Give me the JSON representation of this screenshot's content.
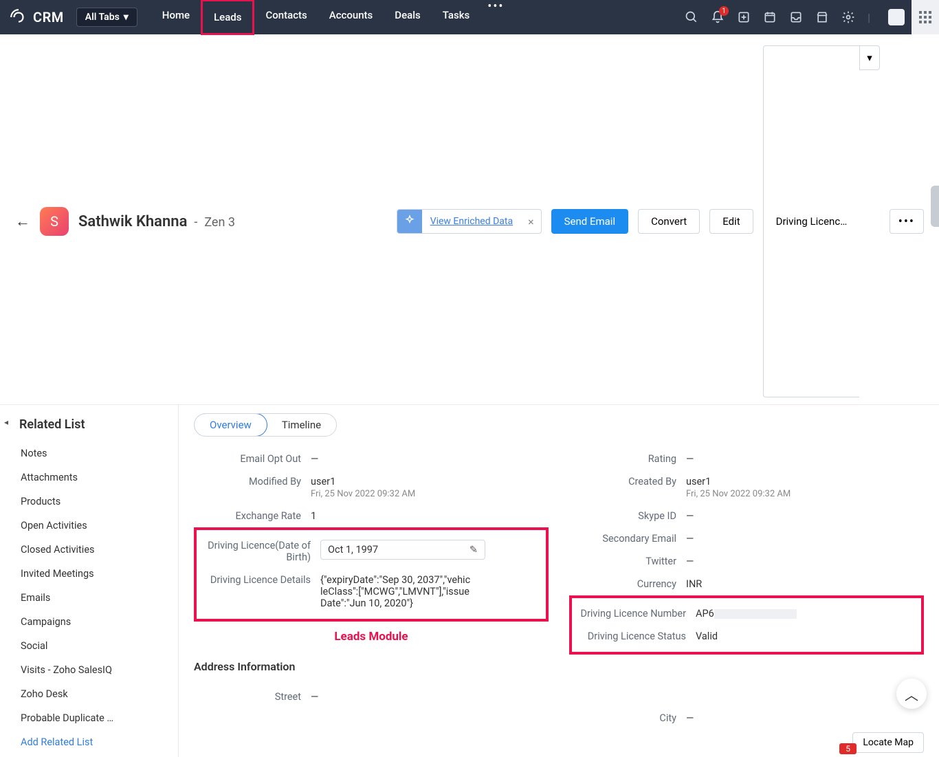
{
  "app": {
    "brand": "CRM"
  },
  "nav": {
    "all_tabs": "All Tabs",
    "links": [
      "Home",
      "Leads",
      "Contacts",
      "Accounts",
      "Deals",
      "Tasks"
    ],
    "notif_count": "1"
  },
  "lead": {
    "initial": "S",
    "name": "Sathwik Khanna",
    "dash": "-",
    "company": "Zen 3"
  },
  "enrich": {
    "icon_text": "✦",
    "link": "View Enriched Data",
    "close": "×"
  },
  "actions": {
    "send_email": "Send Email",
    "convert": "Convert",
    "edit": "Edit",
    "dl_btn": "Driving Licenc…",
    "more": "•••"
  },
  "sidebar": {
    "header": "Related List",
    "items": [
      "Notes",
      "Attachments",
      "Products",
      "Open Activities",
      "Closed Activities",
      "Invited Meetings",
      "Emails",
      "Campaigns",
      "Social",
      "Visits - Zoho SalesIQ",
      "Zoho Desk",
      "Probable Duplicate …"
    ],
    "add": "Add Related List"
  },
  "tabs": {
    "overview": "Overview",
    "timeline": "Timeline"
  },
  "fields_left": {
    "email_opt_out": {
      "label": "Email Opt Out",
      "value": "—"
    },
    "modified_by": {
      "label": "Modified By",
      "value": "user1",
      "sub": "Fri, 25 Nov 2022 09:32 AM"
    },
    "exchange_rate": {
      "label": "Exchange Rate",
      "value": "1"
    },
    "dl_dob": {
      "label": "Driving Licence(Date of Birth)",
      "value": "Oct 1, 1997"
    },
    "dl_details": {
      "label": "Driving Licence Details",
      "value": "{\"expiryDate\":\"Sep 30, 2037\",\"vehicleClass\":[\"MCWG\",\"LMVNT\"],\"issueDate\":\"Jun 10, 2020\"}"
    },
    "street": {
      "label": "Street",
      "value": "—"
    }
  },
  "fields_right": {
    "rating": {
      "label": "Rating",
      "value": "—"
    },
    "created_by": {
      "label": "Created By",
      "value": "user1",
      "sub": "Fri, 25 Nov 2022 09:32 AM"
    },
    "skype": {
      "label": "Skype ID",
      "value": "—"
    },
    "sec_email": {
      "label": "Secondary Email",
      "value": "—"
    },
    "twitter": {
      "label": "Twitter",
      "value": "—"
    },
    "currency": {
      "label": "Currency",
      "value": "INR"
    },
    "dl_number": {
      "label": "Driving Licence Number",
      "value": "AP6"
    },
    "dl_status": {
      "label": "Driving Licence Status",
      "value": "Valid"
    },
    "city": {
      "label": "City",
      "value": "—"
    }
  },
  "annotations": {
    "leads_module": "Leads Module"
  },
  "section": {
    "address": "Address Information"
  },
  "footer": {
    "locate": "Locate Map",
    "count": "5"
  }
}
